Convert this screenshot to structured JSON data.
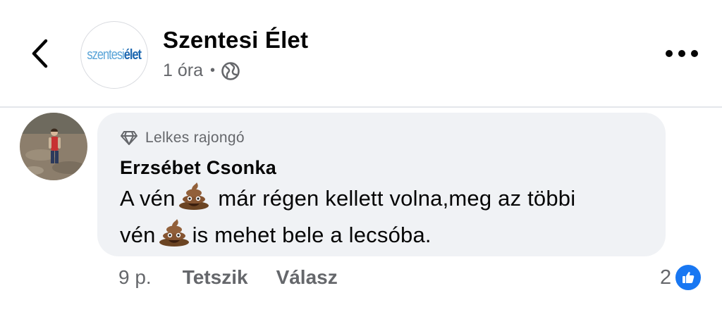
{
  "header": {
    "page_name": "Szentesi Élet",
    "logo_part1": "szentesi",
    "logo_part2": "élet",
    "time": "1 óra",
    "separator": "•",
    "icons": {
      "back": "chevron-left-icon",
      "audience": "globe-icon",
      "more": "more-horizontal-icon"
    }
  },
  "comment": {
    "badge": "Lelkes rajongó",
    "badge_icon": "diamond-icon",
    "author": "Erzsébet Csonka",
    "text_part1": "A vén",
    "text_part2": "már régen kellett volna,meg az többi",
    "text_part3": "vén",
    "text_part4": "is mehet bele a lecsóba.",
    "emoji": "pile-of-poo-emoji"
  },
  "actions": {
    "time": "9 p.",
    "like_label": "Tetszik",
    "reply_label": "Válasz",
    "reaction_count": "2",
    "reaction_icon": "thumbs-up-icon"
  },
  "colors": {
    "accent": "#1877f2",
    "bubble": "#f0f2f5",
    "secondary_text": "#65676b"
  }
}
